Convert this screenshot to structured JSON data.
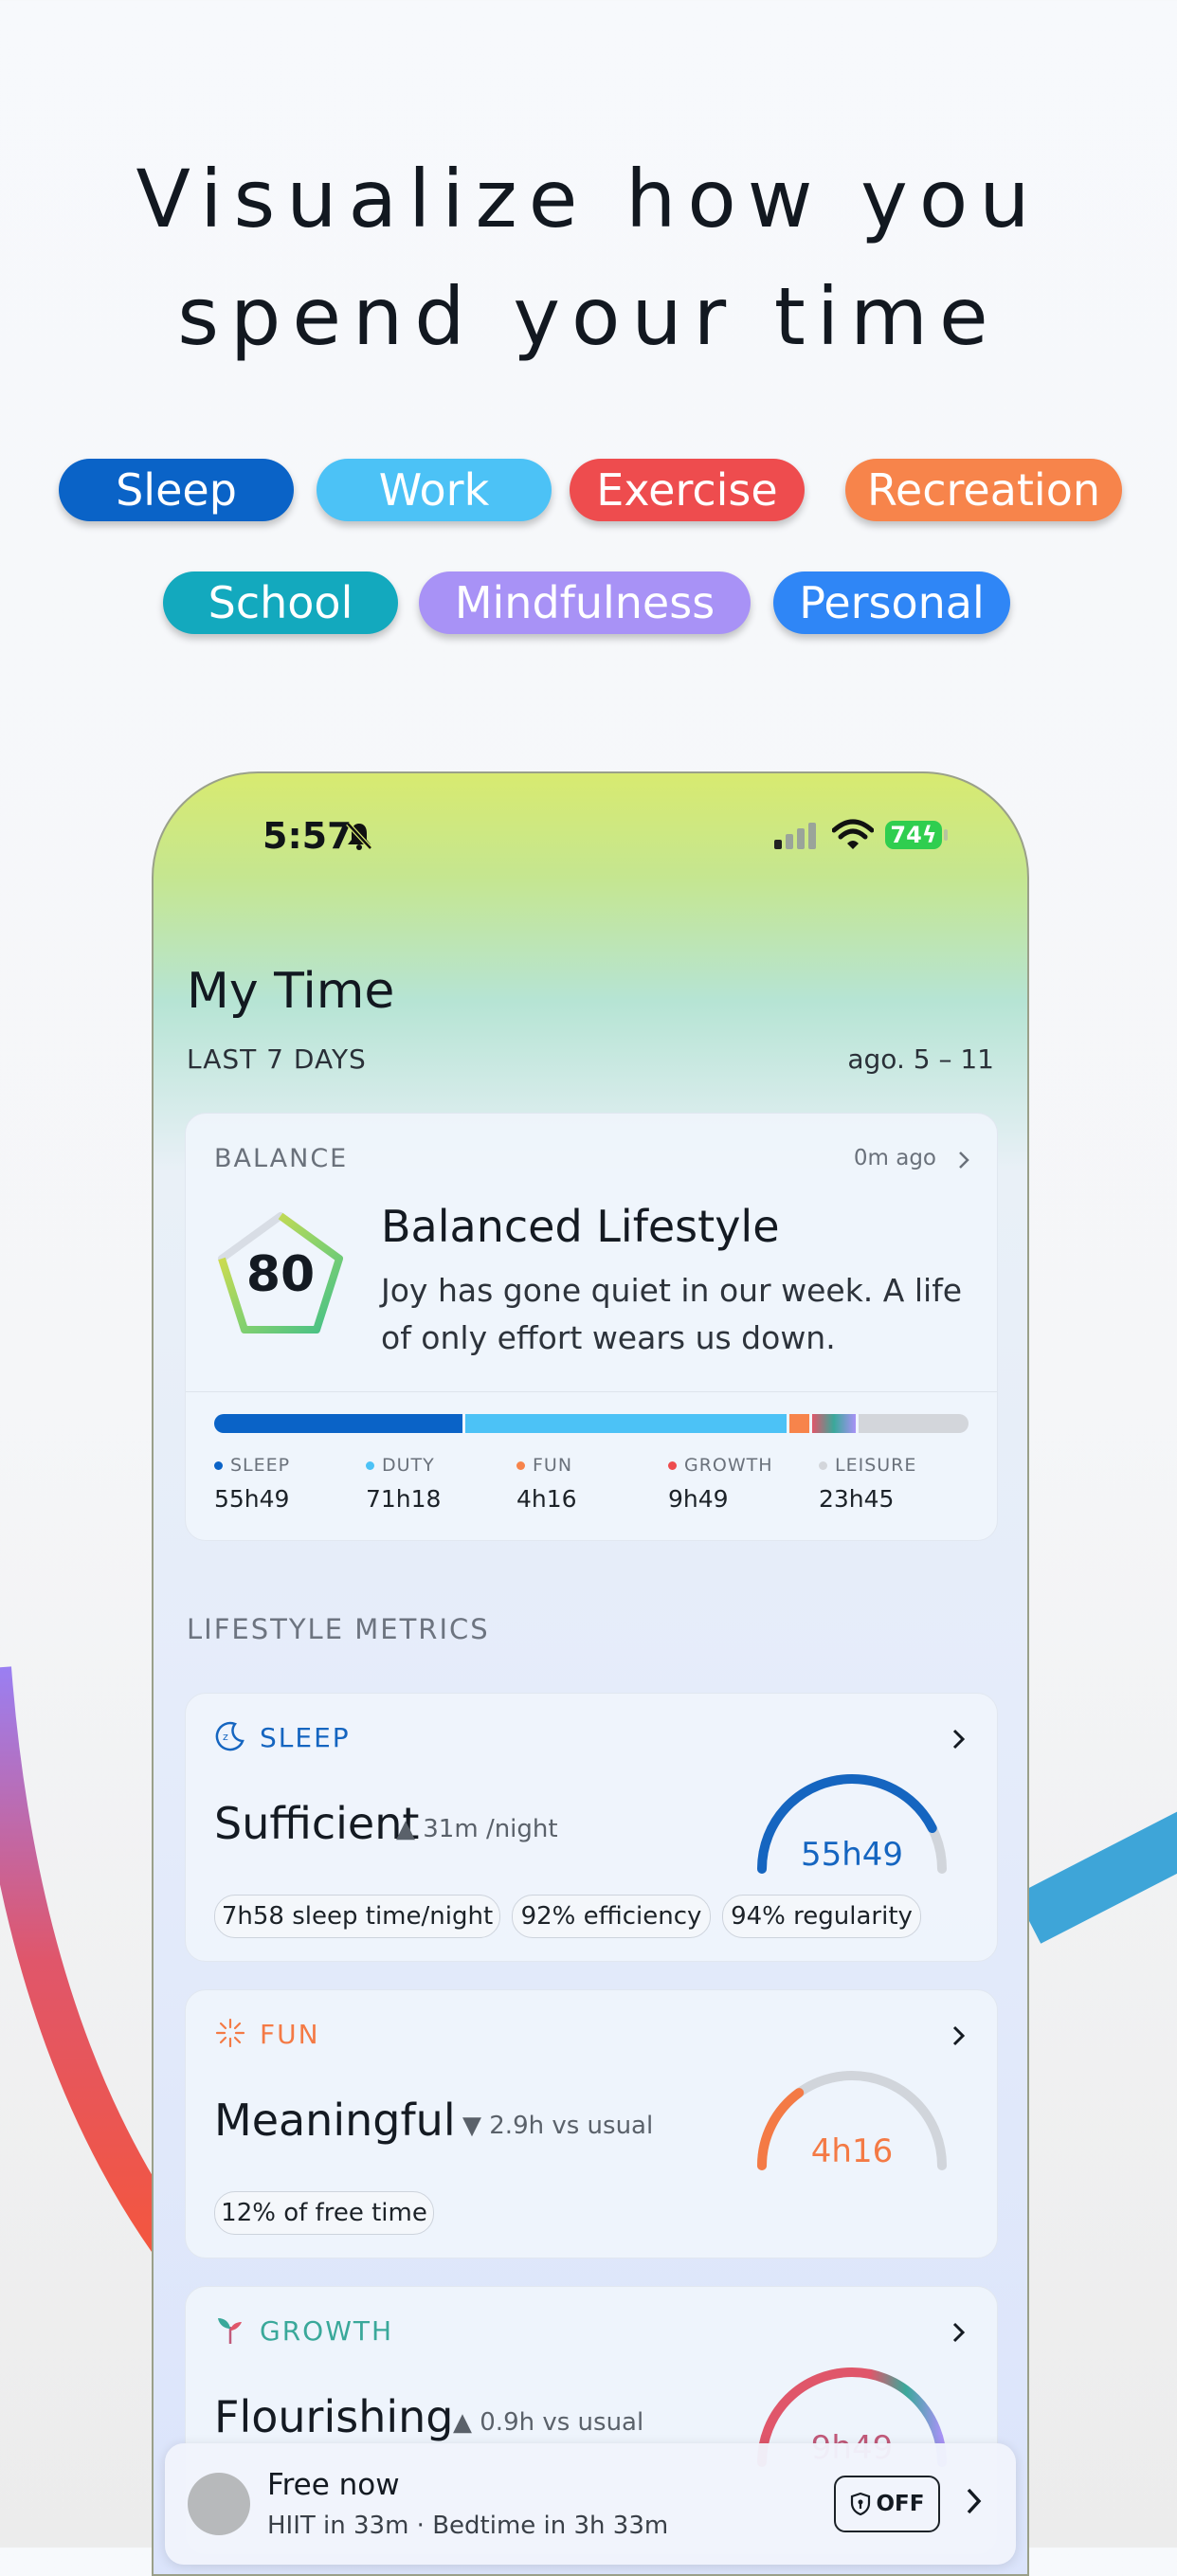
{
  "headline": {
    "line1": "Visualize how you",
    "line2": "spend your time"
  },
  "categories": [
    {
      "label": "Sleep",
      "color": "#0a63c7"
    },
    {
      "label": "Work",
      "color": "#4cc2f6"
    },
    {
      "label": "Exercise",
      "color": "#ee4c4e"
    },
    {
      "label": "Recreation",
      "color": "#f7844b"
    },
    {
      "label": "School",
      "color": "#13a9be"
    },
    {
      "label": "Mindfulness",
      "color": "#a892f6"
    },
    {
      "label": "Personal",
      "color": "#2f86f6"
    }
  ],
  "status_bar": {
    "time": "5:57",
    "battery": "74",
    "icons": [
      "bell-slash-icon",
      "cellular-signal-icon",
      "wifi-icon",
      "battery-charging-icon"
    ]
  },
  "header": {
    "title": "My Time",
    "period": "LAST 7 DAYS",
    "range": "ago. 5 – 11"
  },
  "balance": {
    "label": "BALANCE",
    "updated": "0m ago",
    "score": "80",
    "title": "Balanced Lifestyle",
    "description": "Joy has gone quiet in our week. A life of only effort wears us down.",
    "breakdown": [
      {
        "name": "SLEEP",
        "value": "55h49",
        "color": "#0a63c7",
        "share": 0.34
      },
      {
        "name": "DUTY",
        "value": "71h18",
        "color": "#4cc2f6",
        "share": 0.44
      },
      {
        "name": "FUN",
        "value": "4h16",
        "color": "#f7844b",
        "share": 0.027
      },
      {
        "name": "GROWTH",
        "value": "9h49",
        "color": "#c0698a",
        "share": 0.06
      },
      {
        "name": "LEISURE",
        "value": "23h45",
        "color": "#d3d6db",
        "share": 0.15
      }
    ]
  },
  "section_title": "LIFESTYLE METRICS",
  "metrics": [
    {
      "name": "SLEEP",
      "icon": "sleep-icon",
      "color": "#1565c0",
      "status": "Sufficient",
      "delta_dir": "up",
      "delta": "31m /night",
      "value": "55h49",
      "gauge_fill": 0.85,
      "chips": [
        "7h58 sleep time/night",
        "92% efficiency",
        "94% regularity"
      ]
    },
    {
      "name": "FUN",
      "icon": "fireworks-icon",
      "color": "#f47a45",
      "status": "Meaningful",
      "delta_dir": "down",
      "delta": "2.9h vs usual",
      "value": "4h16",
      "gauge_fill": 0.3,
      "chips": [
        "12% of free time"
      ]
    },
    {
      "name": "GROWTH",
      "icon": "sprout-icon",
      "color": "#3aa89a",
      "status": "Flourishing",
      "delta_dir": "up",
      "delta": "0.9h vs usual",
      "value": "9h49",
      "gauge_fill": 1.0,
      "chips": []
    }
  ],
  "toast": {
    "title": "Free now",
    "subtitle": "HIIT in 33m · Bedtime in 3h 33m",
    "toggle_label": "OFF"
  }
}
